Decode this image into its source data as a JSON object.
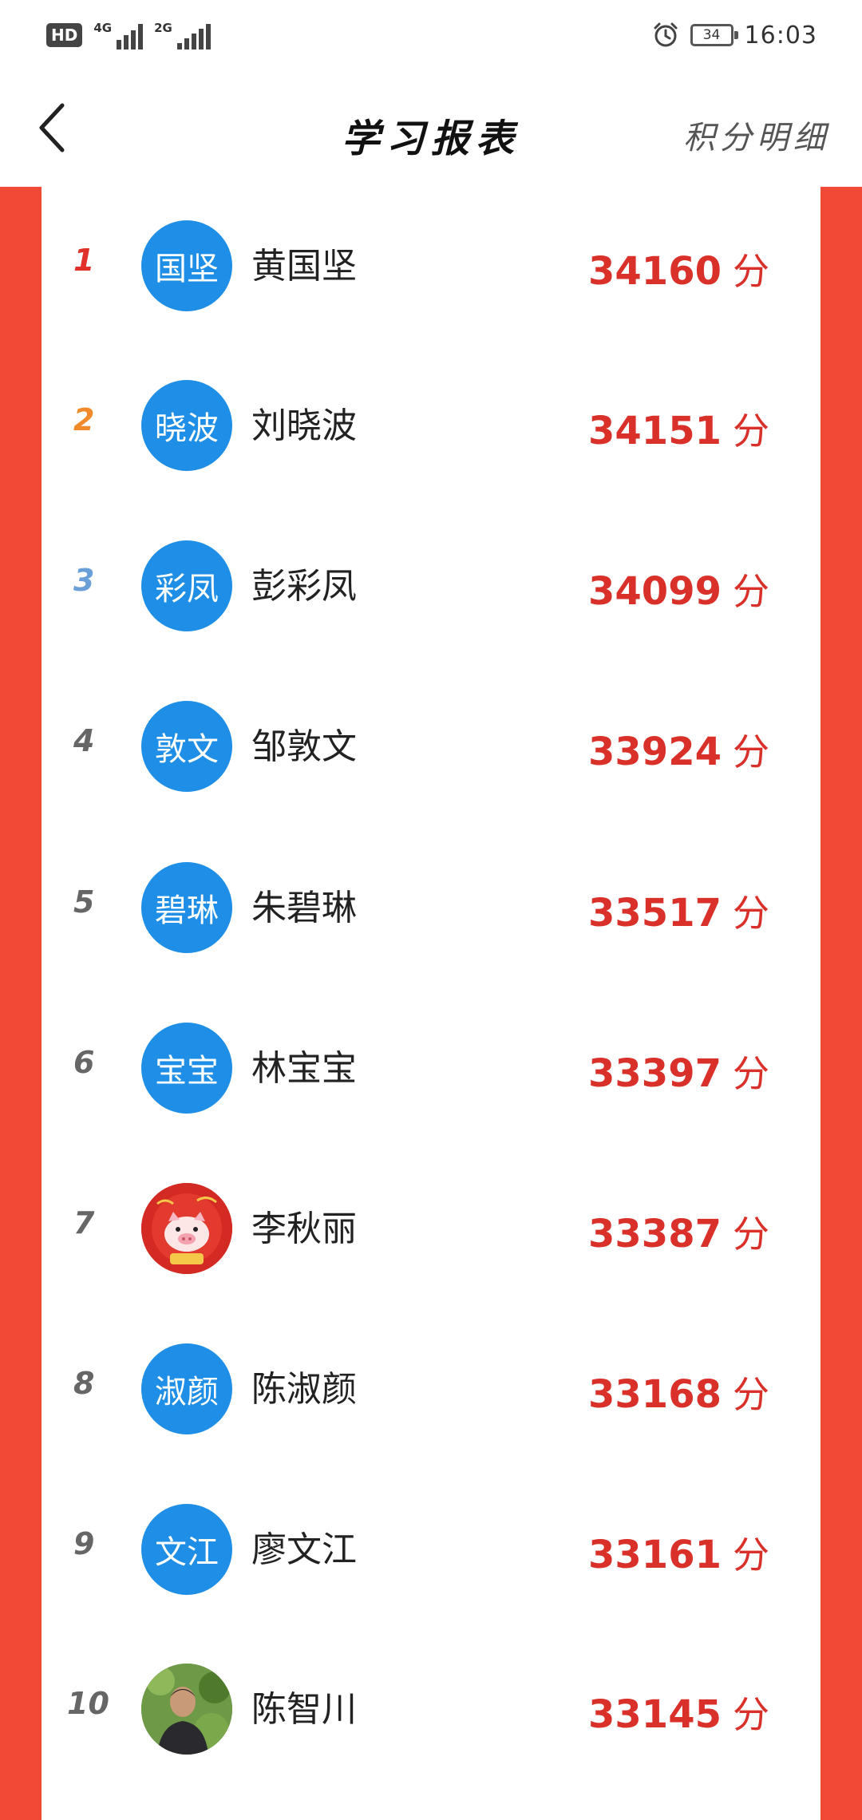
{
  "status_bar": {
    "hd_label": "HD",
    "net1_label": "4G",
    "net2_label": "2G",
    "battery_level": "34",
    "time": "16:03",
    "icons": [
      "hd-icon",
      "signal-4g-icon",
      "signal-2g-icon",
      "alarm-icon",
      "battery-icon"
    ]
  },
  "header": {
    "title": "学习报表",
    "action_label": "积分明细",
    "back_icon": "chevron-left-icon"
  },
  "colors": {
    "frame_red": "#f04a36",
    "score_red": "#d9302a",
    "avatar_blue": "#1e8ee6",
    "rank1": "#e0302a",
    "rank2": "#f08a2a",
    "rank3": "#6a9fd8",
    "rank_other": "#666666"
  },
  "ranking": {
    "unit": "分",
    "rows": [
      {
        "rank": "1",
        "avatar_text": "国坚",
        "avatar_type": "text",
        "name": "黄国坚",
        "score": "34160"
      },
      {
        "rank": "2",
        "avatar_text": "晓波",
        "avatar_type": "text",
        "name": "刘晓波",
        "score": "34151"
      },
      {
        "rank": "3",
        "avatar_text": "彩凤",
        "avatar_type": "text",
        "name": "彭彩凤",
        "score": "34099"
      },
      {
        "rank": "4",
        "avatar_text": "敦文",
        "avatar_type": "text",
        "name": "邹敦文",
        "score": "33924"
      },
      {
        "rank": "5",
        "avatar_text": "碧琳",
        "avatar_type": "text",
        "name": "朱碧琳",
        "score": "33517"
      },
      {
        "rank": "6",
        "avatar_text": "宝宝",
        "avatar_type": "text",
        "name": "林宝宝",
        "score": "33397"
      },
      {
        "rank": "7",
        "avatar_text": "",
        "avatar_type": "pig-photo",
        "name": "李秋丽",
        "score": "33387"
      },
      {
        "rank": "8",
        "avatar_text": "淑颜",
        "avatar_type": "text",
        "name": "陈淑颜",
        "score": "33168"
      },
      {
        "rank": "9",
        "avatar_text": "文江",
        "avatar_type": "text",
        "name": "廖文江",
        "score": "33161"
      },
      {
        "rank": "10",
        "avatar_text": "",
        "avatar_type": "person-photo",
        "name": "陈智川",
        "score": "33145"
      }
    ]
  }
}
